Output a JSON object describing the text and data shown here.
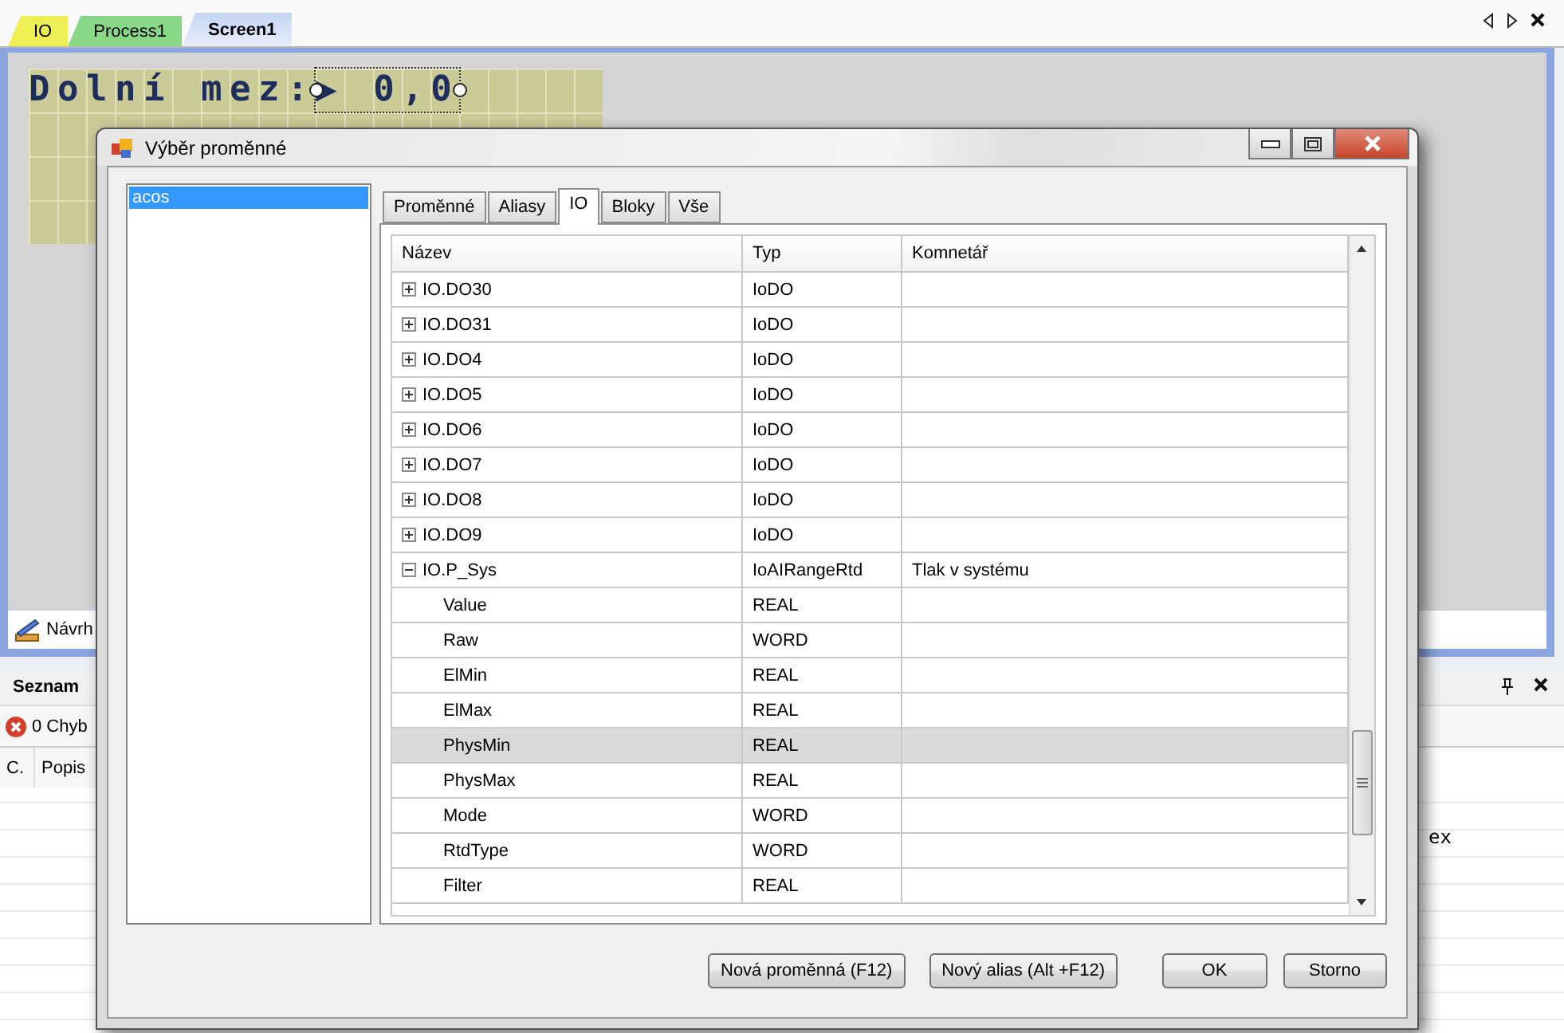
{
  "doc_tabs": [
    {
      "label": "IO",
      "color": "#eeee55",
      "selected": false
    },
    {
      "label": "Process1",
      "color": "#88d888",
      "selected": false
    },
    {
      "label": "Screen1",
      "color": "#c4d6f2",
      "selected": true
    }
  ],
  "lcd": {
    "label": "Dolní mez:",
    "value": "▶ 0,0",
    "value_selected": true
  },
  "view_tab": {
    "label": "Návrh",
    "selected": true
  },
  "panel": {
    "title": "Seznam",
    "errors": "0 Chyb",
    "columns": [
      "C.",
      "Popis"
    ],
    "fragment": "ex"
  },
  "dialog": {
    "title": "Výběr proměnné",
    "list": [
      {
        "label": "acos",
        "selected": true
      }
    ],
    "tabs": [
      {
        "label": "Proměnné",
        "selected": false
      },
      {
        "label": "Aliasy",
        "selected": false
      },
      {
        "label": "IO",
        "selected": true
      },
      {
        "label": "Bloky",
        "selected": false
      },
      {
        "label": "Vše",
        "selected": false
      }
    ],
    "columns": [
      "Název",
      "Typ",
      "Komnetář"
    ],
    "rows": [
      {
        "name": "IO.DO30",
        "type": "IoDO",
        "expanded": false,
        "selected": false
      },
      {
        "name": "IO.DO31",
        "type": "IoDO",
        "expanded": false,
        "selected": false
      },
      {
        "name": "IO.DO4",
        "type": "IoDO",
        "expanded": false,
        "selected": false
      },
      {
        "name": "IO.DO5",
        "type": "IoDO",
        "expanded": false,
        "selected": false
      },
      {
        "name": "IO.DO6",
        "type": "IoDO",
        "expanded": false,
        "selected": false
      },
      {
        "name": "IO.DO7",
        "type": "IoDO",
        "expanded": false,
        "selected": false
      },
      {
        "name": "IO.DO8",
        "type": "IoDO",
        "expanded": false,
        "selected": false
      },
      {
        "name": "IO.DO9",
        "type": "IoDO",
        "expanded": false,
        "selected": false
      },
      {
        "name": "IO.P_Sys",
        "type": "IoAIRangeRtd",
        "comment": "Tlak v systému",
        "expanded": true,
        "selected": false,
        "children": [
          {
            "name": "Value",
            "type": "REAL",
            "selected": false
          },
          {
            "name": "Raw",
            "type": "WORD",
            "selected": false
          },
          {
            "name": "ElMin",
            "type": "REAL",
            "selected": false
          },
          {
            "name": "ElMax",
            "type": "REAL",
            "selected": false
          },
          {
            "name": "PhysMin",
            "type": "REAL",
            "selected": true
          },
          {
            "name": "PhysMax",
            "type": "REAL",
            "selected": false
          },
          {
            "name": "Mode",
            "type": "WORD",
            "selected": false
          },
          {
            "name": "RtdType",
            "type": "WORD",
            "selected": false
          },
          {
            "name": "Filter",
            "type": "REAL",
            "selected": false
          }
        ]
      }
    ],
    "buttons": [
      "Nová proměnná (F12)",
      "Nový alias (Alt +F12)",
      "OK",
      "Storno"
    ]
  }
}
